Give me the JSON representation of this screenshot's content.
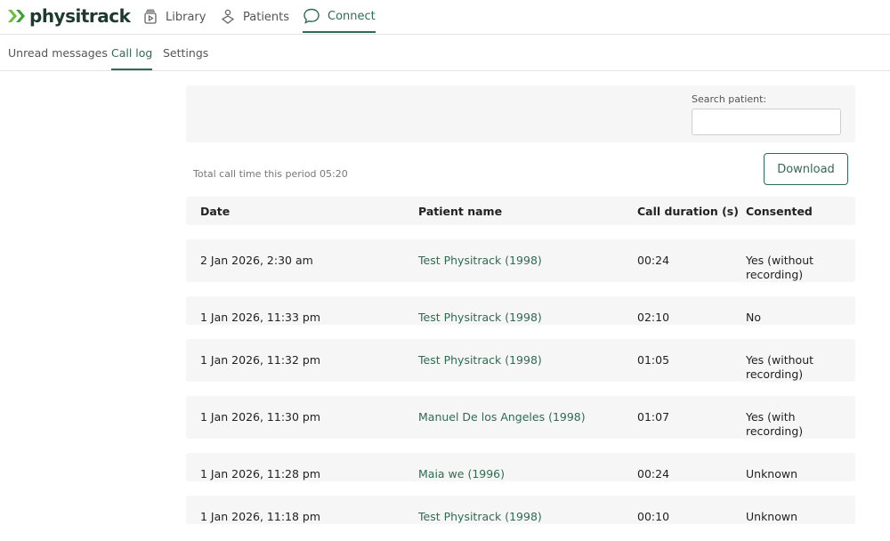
{
  "brand": {
    "name": "physitrack",
    "accent": "#2f6b53"
  },
  "nav": [
    {
      "label": "Library",
      "icon": "library-icon"
    },
    {
      "label": "Patients",
      "icon": "patients-icon"
    },
    {
      "label": "Connect",
      "icon": "chat-bubble-icon",
      "active": true
    }
  ],
  "subnav": [
    {
      "label": "Unread messages"
    },
    {
      "label": "Call log",
      "active": true
    },
    {
      "label": "Settings"
    }
  ],
  "search": {
    "label": "Search patient:",
    "value": "",
    "placeholder": ""
  },
  "summary": {
    "total_call_time": "Total call time this period 05:20"
  },
  "download_label": "Download",
  "table": {
    "headers": {
      "date": "Date",
      "patient": "Patient name",
      "duration": "Call duration (s)",
      "consented": "Consented"
    },
    "rows": [
      {
        "date": "2 Jan 2026, 2:30 am",
        "patient": "Test Physitrack (1998)",
        "duration": "00:24",
        "consented": "Yes (without recording)"
      },
      {
        "date": "1 Jan 2026, 11:33 pm",
        "patient": "Test Physitrack (1998)",
        "duration": "02:10",
        "consented": "No"
      },
      {
        "date": "1 Jan 2026, 11:32 pm",
        "patient": "Test Physitrack (1998)",
        "duration": "01:05",
        "consented": "Yes (without recording)"
      },
      {
        "date": "1 Jan 2026, 11:30 pm",
        "patient": "Manuel De los Angeles (1998)",
        "duration": "01:07",
        "consented": "Yes (with recording)"
      },
      {
        "date": "1 Jan 2026, 11:28 pm",
        "patient": "Maia we (1996)",
        "duration": "00:24",
        "consented": "Unknown"
      },
      {
        "date": "1 Jan 2026, 11:18 pm",
        "patient": "Test Physitrack (1998)",
        "duration": "00:10",
        "consented": "Unknown"
      }
    ]
  }
}
